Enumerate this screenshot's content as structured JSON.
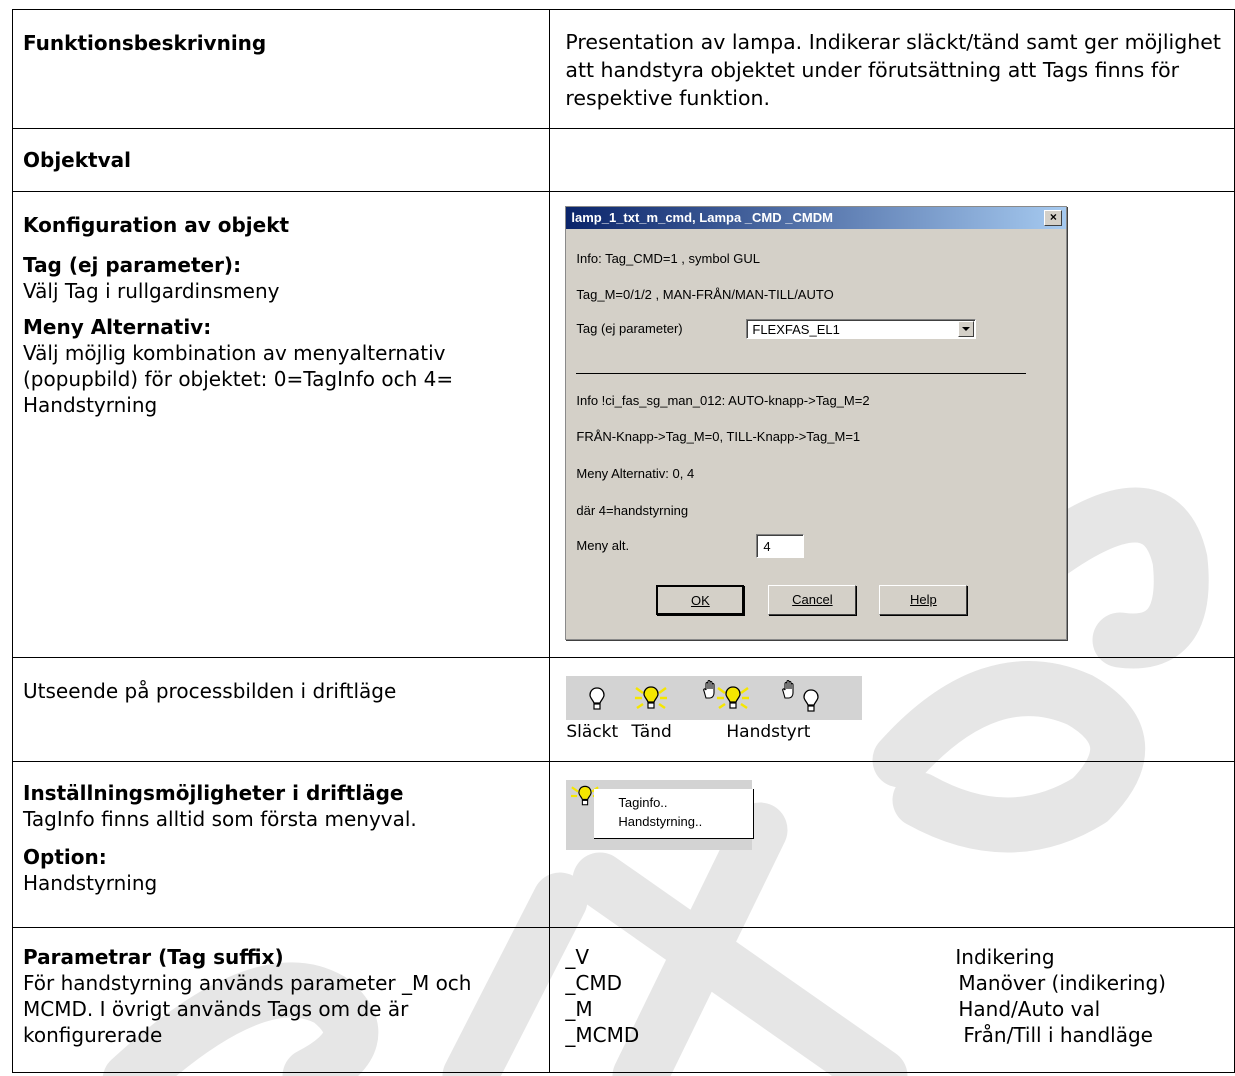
{
  "rows": {
    "funktion": {
      "label": "Funktionsbeskrivning",
      "text": "Presentation av lampa. Indikerar släckt/tänd samt ger möjlighet att handstyra objektet under förutsättning att Tags finns för respektive funktion."
    },
    "objektval": {
      "label": "Objektval"
    },
    "konfig": {
      "heading": "Konfiguration av objekt",
      "tag_label": "Tag (ej parameter):",
      "tag_text": "Välj Tag i rullgardinsmeny",
      "meny_label": "Meny Alternativ:",
      "meny_text": "Välj möjlig kombination av menyalternativ (popupbild) för objektet: 0=TagInfo och 4= Handstyrning"
    },
    "utseende": {
      "label": "Utseende på processbilden i driftläge",
      "caption_slackt": "Släckt",
      "caption_tand": "Tänd",
      "caption_handstyrt": "Handstyrt"
    },
    "installning": {
      "heading": "Inställningsmöjligheter i driftläge",
      "text": "TagInfo finns alltid som första menyval.",
      "option_label": "Option:",
      "option_text": "Handstyrning",
      "menu_items": [
        "Taginfo..",
        "Handstyrning.."
      ]
    },
    "parametrar": {
      "heading": "Parametrar (Tag suffix)",
      "text": "För handstyrning används parameter _M och MCMD.  I övrigt används Tags om de är konfigurerade",
      "params": [
        {
          "suffix": "_V",
          "desc": "Indikering"
        },
        {
          "suffix": "_CMD",
          "desc": "Manöver (indikering)"
        },
        {
          "suffix": "_M",
          "desc": "Hand/Auto val"
        },
        {
          "suffix": "_MCMD",
          "desc": "Från/Till i handläge"
        }
      ]
    }
  },
  "dialog": {
    "title": "lamp_1_txt_m_cmd, Lampa _CMD  _CMDM",
    "close": "×",
    "line1": "Info: Tag_CMD=1 , symbol GUL",
    "line2": "Tag_M=0/1/2 , MAN-FRÅN/MAN-TILL/AUTO",
    "tag_label": "Tag (ej parameter)",
    "tag_value": "FLEXFAS_EL1",
    "line3": "Info !ci_fas_sg_man_012: AUTO-knapp->Tag_M=2",
    "line4": "FRÅN-Knapp->Tag_M=0, TILL-Knapp->Tag_M=1",
    "line5": "Meny Alternativ: 0, 4",
    "line6": "där 4=handstyrning",
    "meny_label": "Meny alt.",
    "meny_value": "4",
    "ok": "OK",
    "cancel": "Cancel",
    "help": "Help"
  },
  "colors": {
    "lamp_on": "#f5e600",
    "watermark": "#e6e6e6",
    "dialog_bg": "#d4d0c8",
    "title_bar": "#0a246a"
  }
}
